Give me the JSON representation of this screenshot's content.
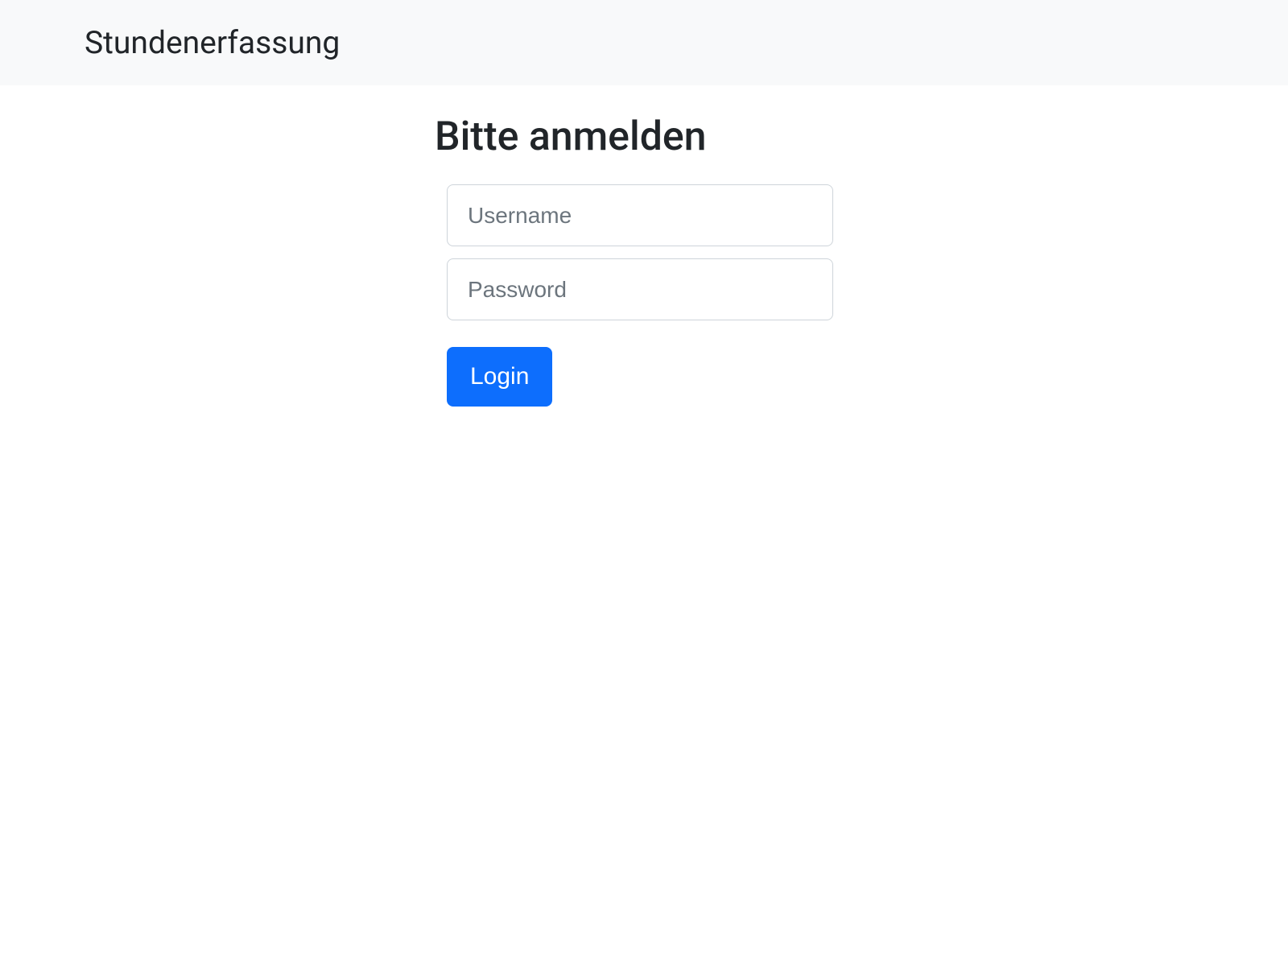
{
  "navbar": {
    "brand": "Stundenerfassung"
  },
  "login": {
    "heading": "Bitte anmelden",
    "username_placeholder": "Username",
    "username_value": "",
    "password_placeholder": "Password",
    "password_value": "",
    "submit_label": "Login"
  }
}
